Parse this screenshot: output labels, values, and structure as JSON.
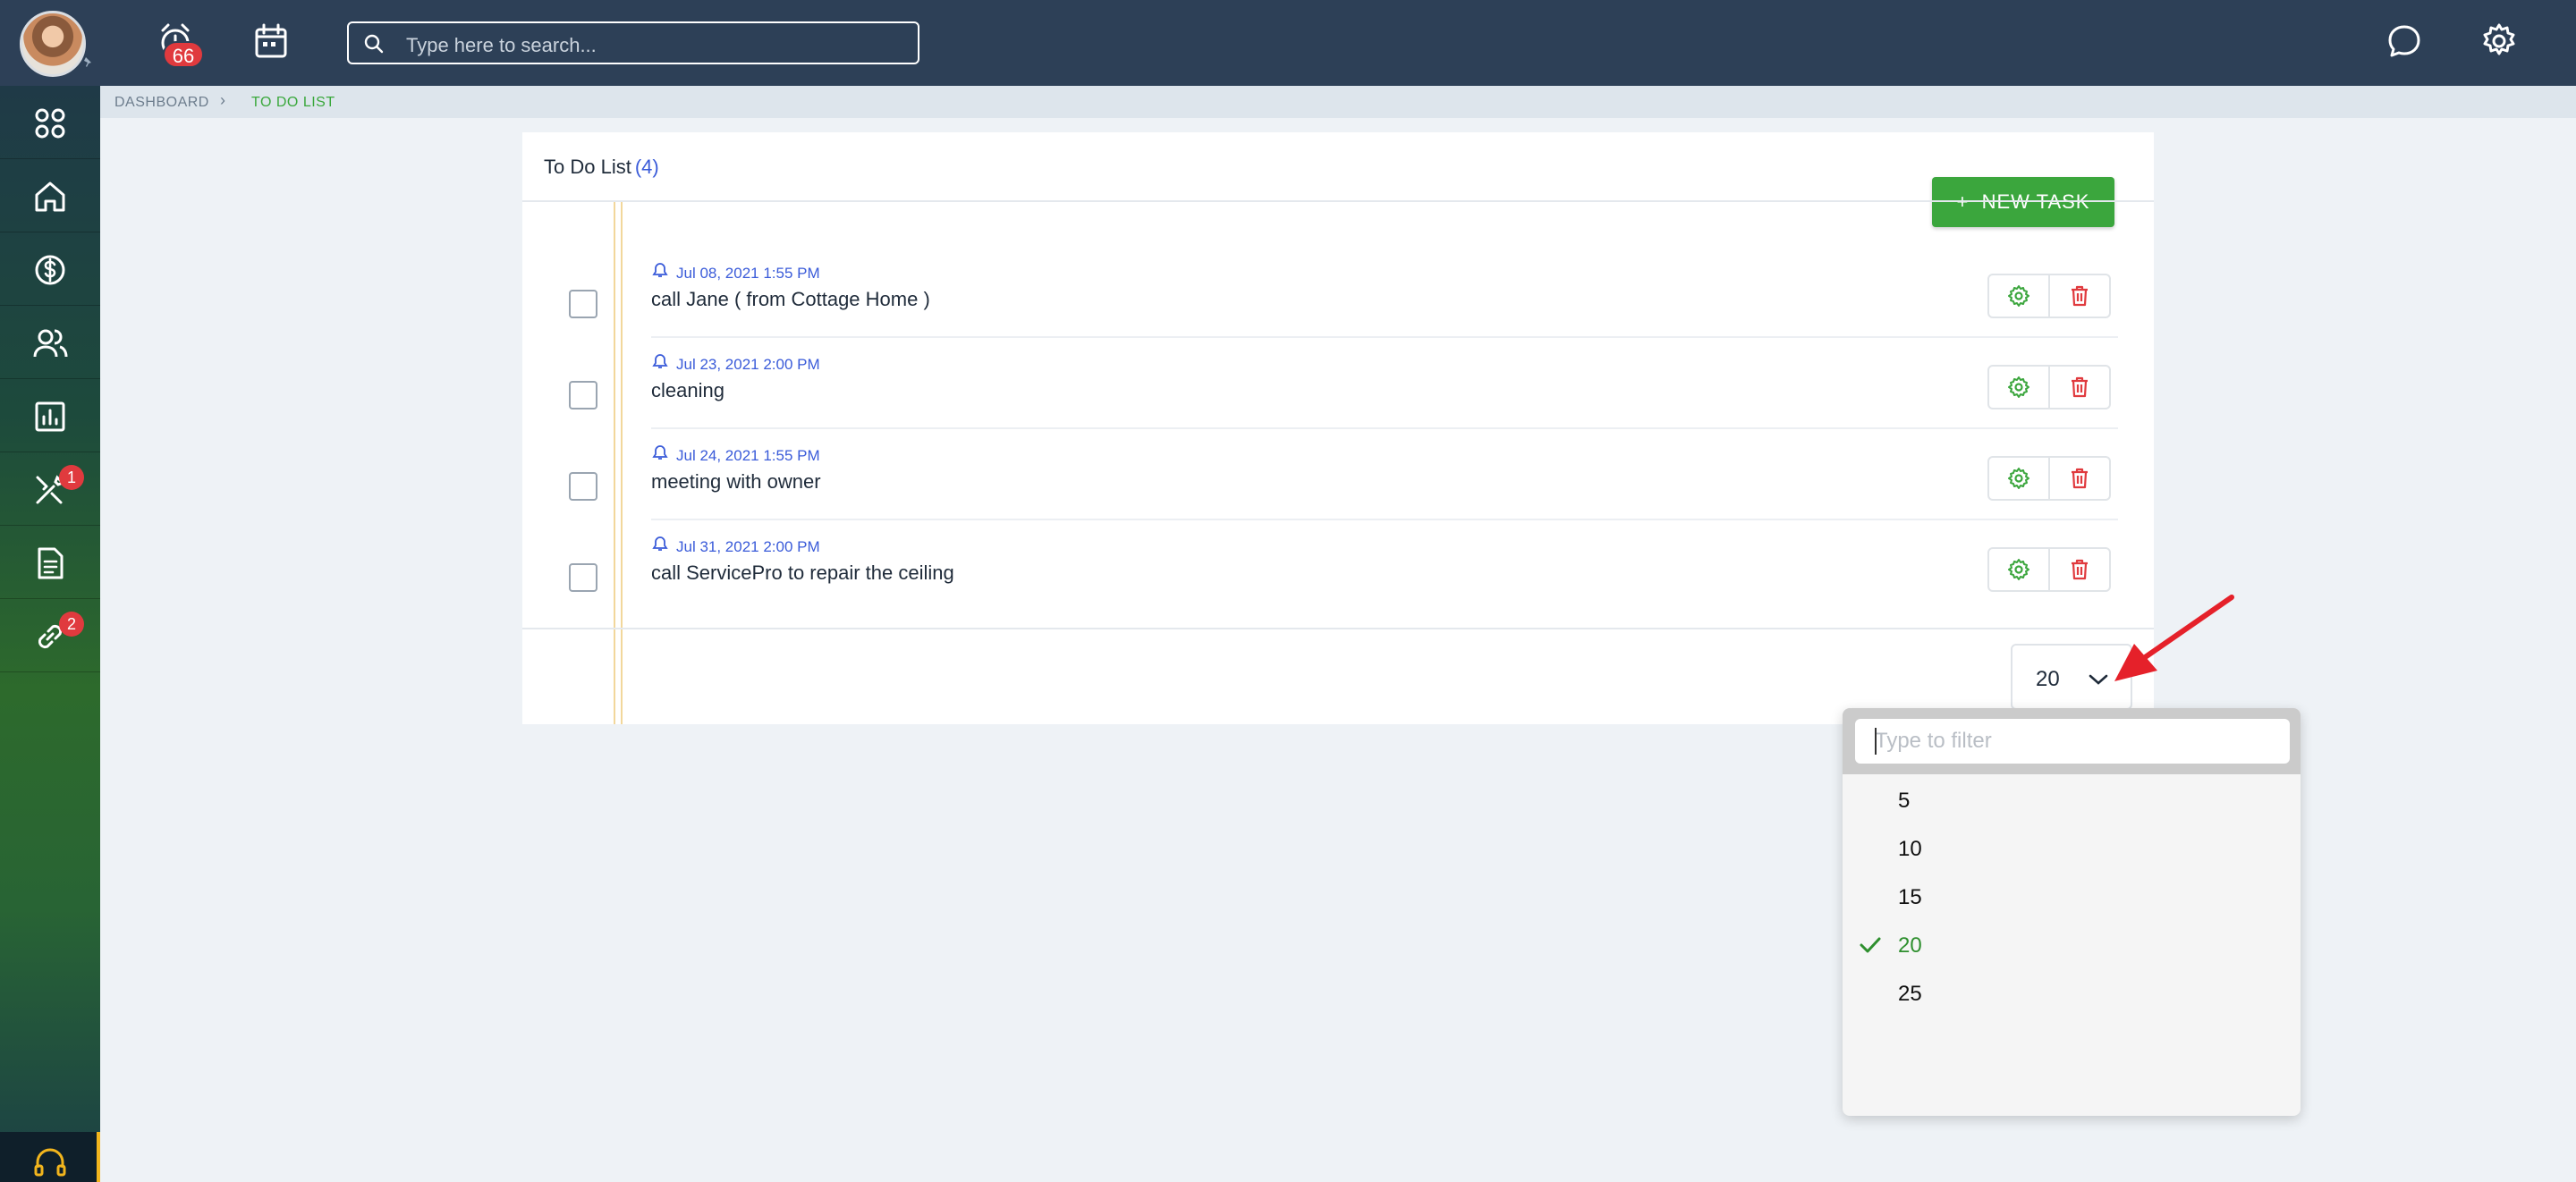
{
  "topbar": {
    "notifications_badge": "66",
    "search": {
      "placeholder": "Type here to search..."
    },
    "icons": [
      "avatar",
      "alarm-clock-icon",
      "calendar-icon",
      "search-icon",
      "chat-icon",
      "gear-icon"
    ]
  },
  "sidebar": {
    "items": [
      {
        "icon": "apps-grid-icon"
      },
      {
        "icon": "home-icon"
      },
      {
        "icon": "dollar-icon"
      },
      {
        "icon": "users-icon"
      },
      {
        "icon": "chart-icon"
      },
      {
        "icon": "tools-icon",
        "badge": "1"
      },
      {
        "icon": "document-icon"
      },
      {
        "icon": "link-icon",
        "badge": "2"
      }
    ],
    "support_icon": "headset-icon"
  },
  "breadcrumb": {
    "dashboard": "DASHBOARD",
    "current": "TO DO LIST"
  },
  "todo": {
    "title": "To Do List",
    "count": "(4)",
    "new_task_label": "NEW TASK",
    "tasks": [
      {
        "date": "Jul 08, 2021 1:55 PM",
        "text": "call Jane ( from Cottage Home )"
      },
      {
        "date": "Jul 23, 2021 2:00 PM",
        "text": "cleaning"
      },
      {
        "date": "Jul 24, 2021 1:55 PM",
        "text": "meeting with owner"
      },
      {
        "date": "Jul 31, 2021 2:00 PM",
        "text": "call ServicePro to repair the ceiling"
      }
    ],
    "page_size": "20"
  },
  "dropdown": {
    "filter_placeholder": "Type to filter",
    "options": [
      "5",
      "10",
      "15",
      "20",
      "25"
    ],
    "selected": "20"
  },
  "colors": {
    "topbar": "#2d4057",
    "accent_green": "#3ba63d",
    "date_blue": "#3a5bd9",
    "delete_red": "#e03a3e"
  }
}
